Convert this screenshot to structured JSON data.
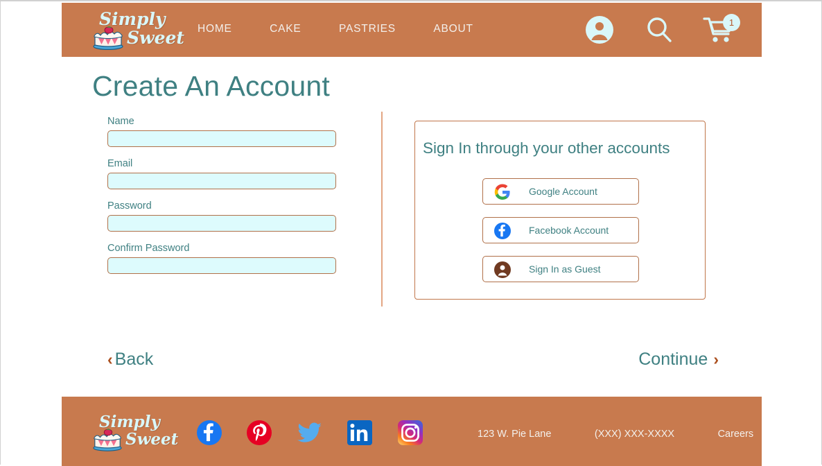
{
  "brand": {
    "line1": "Simply",
    "line2": "Sweet",
    "cake_icon": "cake-icon"
  },
  "colors": {
    "header_brown": "#c87a4e",
    "teal_text": "#3f8082",
    "input_fill": "#ddfbfd",
    "input_border": "#b07049",
    "chevron_rust": "#ab4f1e",
    "divider": "#e3a683",
    "logo_text": "#d9f7f9"
  },
  "header": {
    "nav": [
      {
        "label": "HOME",
        "name": "nav-link-home"
      },
      {
        "label": "CAKE",
        "name": "nav-link-cake"
      },
      {
        "label": "PASTRIES",
        "name": "nav-link-pastries"
      },
      {
        "label": "ABOUT",
        "name": "nav-link-about"
      }
    ],
    "icons": {
      "account": "account-icon",
      "search": "search-icon",
      "cart": "cart-icon"
    },
    "cart_badge_count": "1"
  },
  "main": {
    "title": "Create An Account",
    "fields": [
      {
        "label": "Name",
        "value": "",
        "placeholder": ""
      },
      {
        "label": "Email",
        "value": "",
        "placeholder": ""
      },
      {
        "label": "Password",
        "value": "",
        "placeholder": ""
      },
      {
        "label": "Confirm Password",
        "value": "",
        "placeholder": ""
      }
    ],
    "signin_panel": {
      "heading": "Sign In through your other accounts",
      "buttons": [
        {
          "label": "Google Account",
          "icon": "google-icon"
        },
        {
          "label": "Facebook Account",
          "icon": "facebook-icon"
        },
        {
          "label": "Sign In as Guest",
          "icon": "guest-person-icon"
        }
      ]
    },
    "back_label": "Back",
    "back_chevron": "‹",
    "continue_label": "Continue",
    "continue_chevron": "›"
  },
  "footer": {
    "social": [
      {
        "name": "facebook-icon",
        "label": "Facebook"
      },
      {
        "name": "pinterest-icon",
        "label": "Pinterest"
      },
      {
        "name": "twitter-icon",
        "label": "Twitter"
      },
      {
        "name": "linkedin-icon",
        "label": "LinkedIn"
      },
      {
        "name": "instagram-icon",
        "label": "Instagram"
      }
    ],
    "info": [
      {
        "label": "123 W. Pie Lane",
        "name": "footer-address"
      },
      {
        "label": "(XXX) XXX-XXXX",
        "name": "footer-phone"
      },
      {
        "label": "Careers",
        "name": "footer-careers-link"
      }
    ]
  }
}
